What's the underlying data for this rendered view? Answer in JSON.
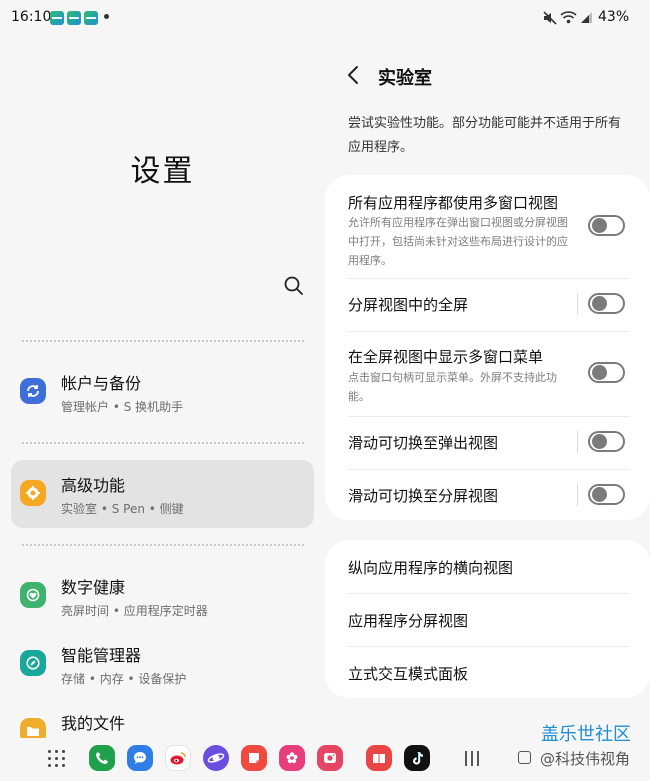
{
  "status_bar": {
    "time": "16:10",
    "notification_icons": [
      "app-notification-icon",
      "app-notification-icon",
      "app-notification-icon"
    ],
    "battery_percent": "43%"
  },
  "settings": {
    "title": "设置",
    "items": [
      {
        "title": "帐户与备份",
        "subtitle": "管理帐户 • S 换机助手",
        "icon": "sync-icon",
        "color": "#3e6fd9"
      },
      {
        "title": "高级功能",
        "subtitle": "实验室 • S Pen • 侧键",
        "icon": "star-gear-icon",
        "color": "#f5a821",
        "selected": true
      },
      {
        "title": "数字健康",
        "subtitle": "亮屏时间 • 应用程序定时器",
        "icon": "heart-icon",
        "color": "#3fb26d"
      },
      {
        "title": "智能管理器",
        "subtitle": "存储 • 内存 • 设备保护",
        "icon": "compass-icon",
        "color": "#18a89a"
      },
      {
        "title": "我的文件",
        "subtitle": "",
        "icon": "folder-icon",
        "color": "#f0ad2c"
      }
    ]
  },
  "labs": {
    "title": "实验室",
    "description": "尝试实验性功能。部分功能可能并不适用于所有应用程序。",
    "toggles": [
      {
        "title": "所有应用程序都使用多窗口视图",
        "description": "允许所有应用程序在弹出窗口视图或分屏视图中打开，包括尚未针对这些布局进行设计的应用程序。",
        "on": false
      },
      {
        "title": "分屏视图中的全屏",
        "description": "",
        "on": false
      },
      {
        "title": "在全屏视图中显示多窗口菜单",
        "description": "点击窗口句柄可显示菜单。外屏不支持此功能。",
        "on": false
      },
      {
        "title": "滑动可切换至弹出视图",
        "description": "",
        "on": false
      },
      {
        "title": "滑动可切换至分屏视图",
        "description": "",
        "on": false
      }
    ],
    "links": [
      {
        "title": "纵向应用程序的横向视图"
      },
      {
        "title": "应用程序分屏视图"
      },
      {
        "title": "立式交互模式面板"
      }
    ]
  },
  "taskbar": {
    "apps": [
      {
        "icon": "phone-icon",
        "color": "#1fa14b"
      },
      {
        "icon": "messages-icon",
        "color": "#2f7ee8"
      },
      {
        "icon": "weibo-icon",
        "color": "#ffffff"
      },
      {
        "icon": "internet-icon",
        "color": "#6a4ee0"
      },
      {
        "icon": "notes-icon",
        "color": "#f04a3f"
      },
      {
        "icon": "gallery-icon",
        "color": "#e83e7c"
      },
      {
        "icon": "camera-icon",
        "color": "#e64463"
      },
      {
        "icon": "reader-icon",
        "color": "#e94545"
      },
      {
        "icon": "tiktok-icon",
        "color": "#111111"
      }
    ]
  },
  "watermark": {
    "brand": "盖乐世社区",
    "author": "@科技伟视角"
  }
}
